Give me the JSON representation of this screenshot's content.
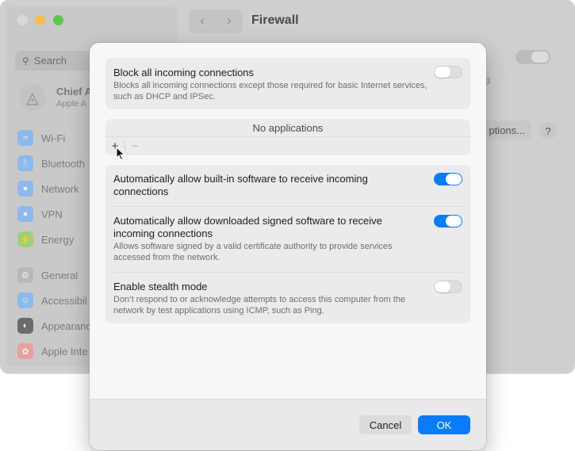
{
  "background_window": {
    "title": "Firewall",
    "search_placeholder": "Search",
    "account": {
      "name": "Chief A",
      "subtitle": "Apple A"
    },
    "sidebar": [
      {
        "label": "Wi-Fi",
        "color": "#5a9ef0"
      },
      {
        "label": "Bluetooth",
        "color": "#5a9ef0"
      },
      {
        "label": "Network",
        "color": "#5a9ef0"
      },
      {
        "label": "VPN",
        "color": "#5a9ef0"
      },
      {
        "label": "Energy",
        "color": "#8ccf5a"
      },
      {
        "label": "General",
        "color": "#a7a7a7"
      },
      {
        "label": "Accessibil",
        "color": "#5a9ef0"
      },
      {
        "label": "Appearanc",
        "color": "#444444"
      },
      {
        "label": "Apple Inte",
        "color": "#e0837a"
      }
    ],
    "options_button_fragment": "ptions...",
    "right_fragment": "g"
  },
  "sheet": {
    "block_all": {
      "title": "Block all incoming connections",
      "description": "Blocks all incoming connections except those required for basic Internet services, such as DHCP and IPSec.",
      "enabled": false
    },
    "apps": {
      "empty_text": "No applications",
      "add_symbol": "+",
      "remove_symbol": "−"
    },
    "builtin": {
      "title": "Automatically allow built-in software to receive incoming connections",
      "enabled": true
    },
    "signed": {
      "title": "Automatically allow downloaded signed software to receive incoming connections",
      "description": "Allows software signed by a valid certificate authority to provide services accessed from the network.",
      "enabled": true
    },
    "stealth": {
      "title": "Enable stealth mode",
      "description": "Don’t respond to or acknowledge attempts to access this computer from the network by test applications using ICMP, such as Ping.",
      "enabled": false
    },
    "buttons": {
      "cancel": "Cancel",
      "ok": "OK"
    }
  },
  "colors": {
    "accent": "#0a7cf7"
  }
}
